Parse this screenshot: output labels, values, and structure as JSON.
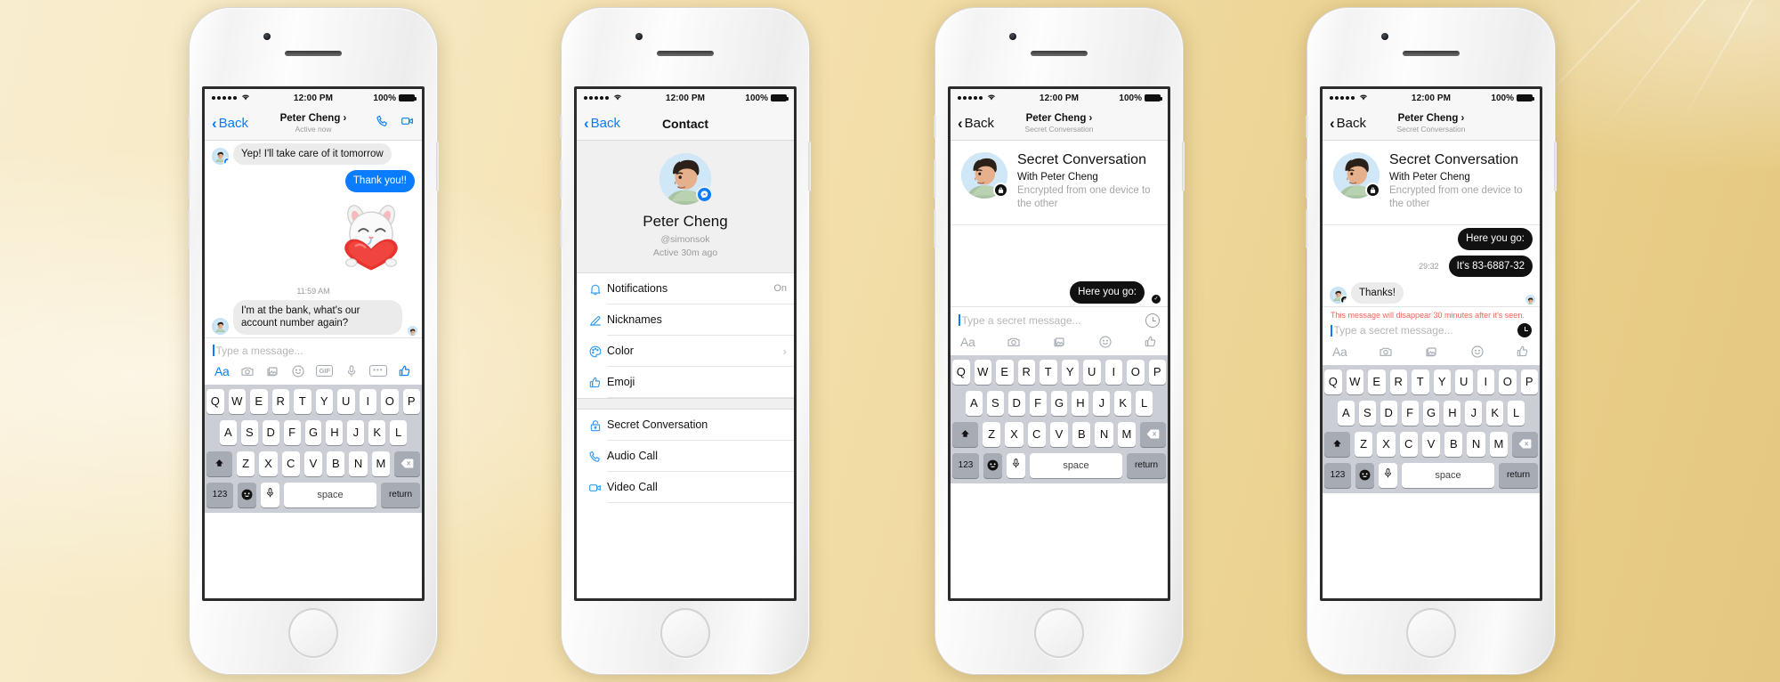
{
  "background": {
    "color_left": "#f8edcf",
    "color_right": "#e5c87f"
  },
  "status_bar": {
    "time": "12:00 PM",
    "battery": "100%",
    "signal_dots": 5,
    "wifi_icon": "wifi-icon"
  },
  "accent": {
    "blue": "#0a7cff",
    "icon_blue": "#2f9bf0",
    "black": "#111111",
    "warning_red": "#f4645c"
  },
  "keyboard": {
    "row1": [
      "Q",
      "W",
      "E",
      "R",
      "T",
      "Y",
      "U",
      "I",
      "O",
      "P"
    ],
    "row2": [
      "A",
      "S",
      "D",
      "F",
      "G",
      "H",
      "J",
      "K",
      "L"
    ],
    "row3": [
      "Z",
      "X",
      "C",
      "V",
      "B",
      "N",
      "M"
    ],
    "shift_label": "⬆",
    "backspace_label": "⌫",
    "numbers_label": "123",
    "emoji_label": "☺",
    "mic_label": "mic-icon",
    "space_label": "space",
    "return_label": "return"
  },
  "phones": [
    {
      "id": "phone-chat",
      "nav": {
        "back_label": "Back",
        "title": "Peter Cheng",
        "title_chevron": "›",
        "subtitle": "Active now",
        "back_color": "#0a7cff",
        "actions": [
          {
            "name": "audio-call-icon"
          },
          {
            "name": "video-call-icon"
          }
        ]
      },
      "messages": [
        {
          "side": "left",
          "type": "text",
          "text": "Yep! I'll take care of it tomorrow",
          "avatar": true,
          "badge": "messenger"
        },
        {
          "side": "right",
          "type": "text",
          "text": "Thank you!!",
          "style": "blue"
        },
        {
          "side": "right",
          "type": "sticker",
          "sticker": "cat-hugging-heart-sticker"
        },
        {
          "side": "center",
          "type": "timestamp",
          "text": "11:59 AM"
        },
        {
          "side": "left",
          "type": "text",
          "text": "I'm at the bank, what's our account number again?",
          "avatar": true,
          "seen_mini": true
        }
      ],
      "composer": {
        "placeholder": "Type a message...",
        "timer": false
      },
      "toolbar": [
        {
          "name": "text-format-icon",
          "label": "Aa",
          "active": true
        },
        {
          "name": "camera-icon"
        },
        {
          "name": "photos-icon"
        },
        {
          "name": "emoji-icon"
        },
        {
          "name": "gif-icon",
          "label": "GIF"
        },
        {
          "name": "microphone-icon"
        },
        {
          "name": "more-options-icon"
        },
        {
          "name": "thumbs-up-icon",
          "active": true
        }
      ],
      "keyboard": true
    },
    {
      "id": "phone-contact",
      "nav": {
        "back_label": "Back",
        "title": "Contact",
        "back_color": "#0a7cff",
        "title_big": true
      },
      "profile": {
        "name": "Peter Cheng",
        "handle": "@simonsok",
        "active": "Active 30m ago",
        "badge": "messenger"
      },
      "list_groups": [
        [
          {
            "icon": "bell-icon",
            "label": "Notifications",
            "value": "On"
          },
          {
            "icon": "pencil-icon",
            "label": "Nicknames"
          },
          {
            "icon": "palette-icon",
            "label": "Color",
            "chevron": "›"
          },
          {
            "icon": "thumbs-up-icon",
            "label": "Emoji"
          }
        ],
        [
          {
            "icon": "lock-icon",
            "label": "Secret Conversation"
          },
          {
            "icon": "phone-icon",
            "label": "Audio Call"
          },
          {
            "icon": "video-icon",
            "label": "Video Call"
          }
        ]
      ]
    },
    {
      "id": "phone-secret-empty",
      "nav": {
        "back_label": "Back",
        "title": "Peter Cheng",
        "title_chevron": "›",
        "subtitle": "Secret Conversation",
        "back_color": "#111111"
      },
      "secret_card": {
        "title": "Secret Conversation",
        "subtitle": "With Peter Cheng",
        "description": "Encrypted from one device to the other",
        "badge": "lock"
      },
      "messages": [
        {
          "side": "right",
          "type": "text",
          "text": "Here you go:",
          "style": "black",
          "seen": true
        }
      ],
      "composer": {
        "placeholder": "Type a secret message...",
        "timer": true,
        "timer_filled": false
      },
      "toolbar": [
        {
          "name": "text-format-icon",
          "label": "Aa"
        },
        {
          "name": "camera-icon"
        },
        {
          "name": "photos-icon"
        },
        {
          "name": "emoji-icon"
        },
        {
          "name": "thumbs-up-icon"
        }
      ],
      "keyboard": true
    },
    {
      "id": "phone-secret-chat",
      "nav": {
        "back_label": "Back",
        "title": "Peter Cheng",
        "title_chevron": "›",
        "subtitle": "Secret Conversation",
        "back_color": "#111111"
      },
      "secret_card": {
        "title": "Secret Conversation",
        "subtitle": "With Peter Cheng",
        "description": "Encrypted from one device to the other",
        "badge": "lock"
      },
      "messages": [
        {
          "side": "right",
          "type": "text",
          "text": "Here you go:",
          "style": "black"
        },
        {
          "side": "right",
          "type": "text",
          "text": "It's 83-6887-32",
          "style": "black",
          "countdown": "29:32"
        },
        {
          "side": "left",
          "type": "text",
          "text": "Thanks!",
          "avatar": true,
          "badge": "lock",
          "seen_mini": true
        }
      ],
      "disappear_note": "This message will disappear 30 minutes after it's seen.",
      "composer": {
        "placeholder": "Type a secret message...",
        "timer": true,
        "timer_filled": true
      },
      "toolbar": [
        {
          "name": "text-format-icon",
          "label": "Aa"
        },
        {
          "name": "camera-icon"
        },
        {
          "name": "photos-icon"
        },
        {
          "name": "emoji-icon"
        },
        {
          "name": "thumbs-up-icon"
        }
      ],
      "keyboard": true
    }
  ]
}
